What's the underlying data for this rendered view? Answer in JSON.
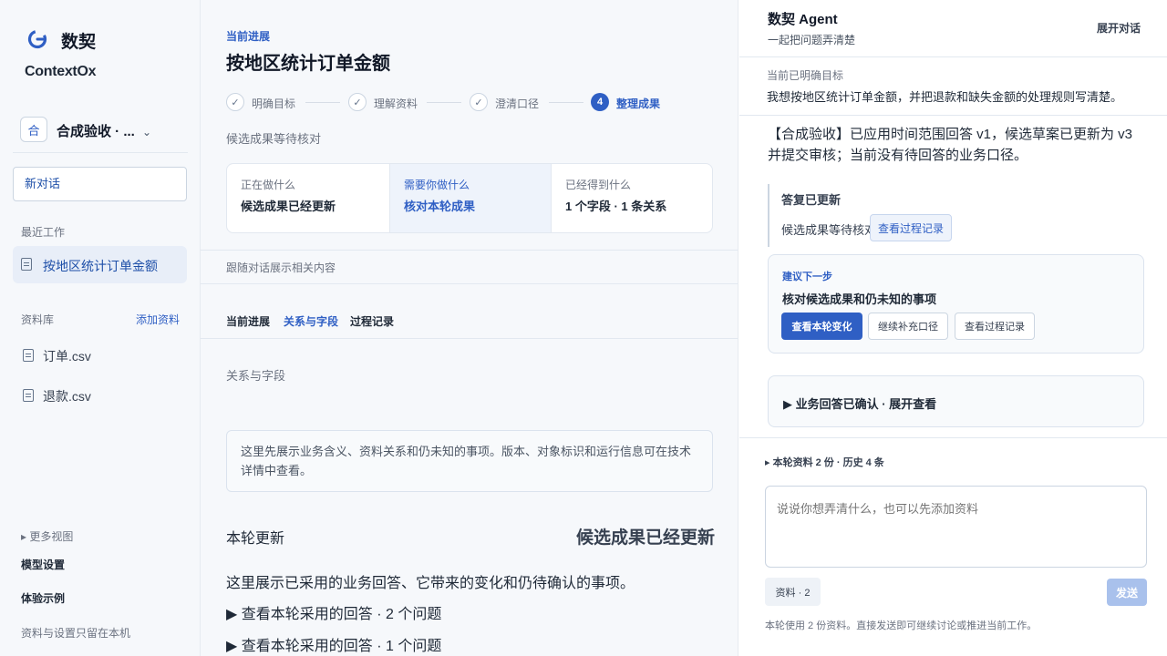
{
  "sidebar": {
    "brand": "数契",
    "brand_sub": "ContextOx",
    "workspace_badge": "合",
    "workspace_name": "合成验收 · ...",
    "new_chat": "新对话",
    "recent_label": "最近工作",
    "recent_item": "按地区统计订单金额",
    "library_label": "资料库",
    "add_material": "添加资料",
    "files": [
      "订单.csv",
      "退款.csv"
    ],
    "more_views": "▸ 更多视图",
    "model_settings": "模型设置",
    "demo_examples": "体验示例",
    "footer": "资料与设置只留在本机"
  },
  "main": {
    "kicker": "当前进展",
    "title": "按地区统计订单金额",
    "steps": [
      {
        "label": "明确目标",
        "mark": "✓"
      },
      {
        "label": "理解资料",
        "mark": "✓"
      },
      {
        "label": "澄清口径",
        "mark": "✓"
      },
      {
        "label": "整理成果",
        "mark": "4"
      }
    ],
    "status": "候选成果等待核对",
    "cards": [
      {
        "k": "正在做什么",
        "v": "候选成果已经更新"
      },
      {
        "k": "需要你做什么",
        "v": "核对本轮成果"
      },
      {
        "k": "已经得到什么",
        "v": "1 个字段 · 1 条关系"
      }
    ],
    "follow_text": "跟随对话展示相关内容",
    "tabs": [
      "当前进展",
      "关系与字段",
      "过程记录"
    ],
    "rel_label": "关系与字段",
    "notice": "这里先展示业务含义、资料关系和仍未知的事项。版本、对象标识和运行信息可在技术详情中查看。",
    "update_left": "本轮更新",
    "update_right": "候选成果已经更新",
    "update_desc": "这里展示已采用的业务回答、它带来的变化和仍待确认的事项。",
    "expanders": [
      "▶ 查看本轮采用的回答 · 2 个问题",
      "▶ 查看本轮采用的回答 · 1 个问题"
    ]
  },
  "agent": {
    "title": "数契 Agent",
    "subtitle": "一起把问题弄清楚",
    "expand": "展开对话",
    "goal_label": "当前已明确目标",
    "goal": "我想按地区统计订单金额，并把退款和缺失金额的处理规则写清楚。",
    "message": "【合成验收】已应用时间范围回答 v1，候选草案已更新为 v3 并提交审核；当前没有待回答的业务口径。",
    "reply_title": "答复已更新",
    "reply_text": "候选成果等待核对",
    "reply_button": "查看过程记录",
    "suggest_kicker": "建议下一步",
    "suggest_title": "核对候选成果和仍未知的事项",
    "suggest_buttons": [
      "查看本轮变化",
      "继续补充口径",
      "查看过程记录"
    ],
    "confirm": "▶ 业务回答已确认 · 展开查看",
    "resources": "▸ 本轮资料 2 份 · 历史 4 条",
    "input_placeholder": "说说你想弄清什么，也可以先添加资料",
    "chip": "资料 · 2",
    "send": "发送",
    "note": "本轮使用 2 份资料。直接发送即可继续讨论或推进当前工作。"
  },
  "icons": {
    "logo": "brand-g-icon",
    "file": "file-icon",
    "check": "check-icon",
    "chevron": "chevron-down-icon"
  },
  "colors": {
    "accent": "#2f5fc4",
    "active_bg": "#e8eef8"
  }
}
